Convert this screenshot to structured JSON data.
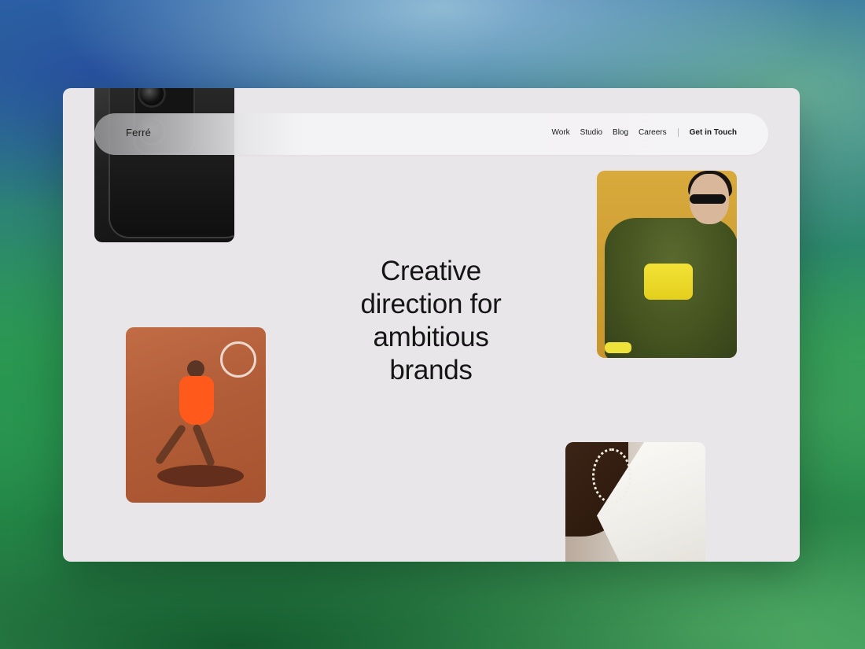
{
  "nav": {
    "brand": "Ferré",
    "links": [
      "Work",
      "Studio",
      "Blog",
      "Careers"
    ],
    "cta": "Get in Touch"
  },
  "hero": {
    "title_lines": [
      "Creative",
      "direction for",
      "ambitious",
      "brands"
    ]
  },
  "colors": {
    "page_background": "#e8e6e8",
    "nav_background": "#f4f3f5",
    "text": "#151515"
  }
}
